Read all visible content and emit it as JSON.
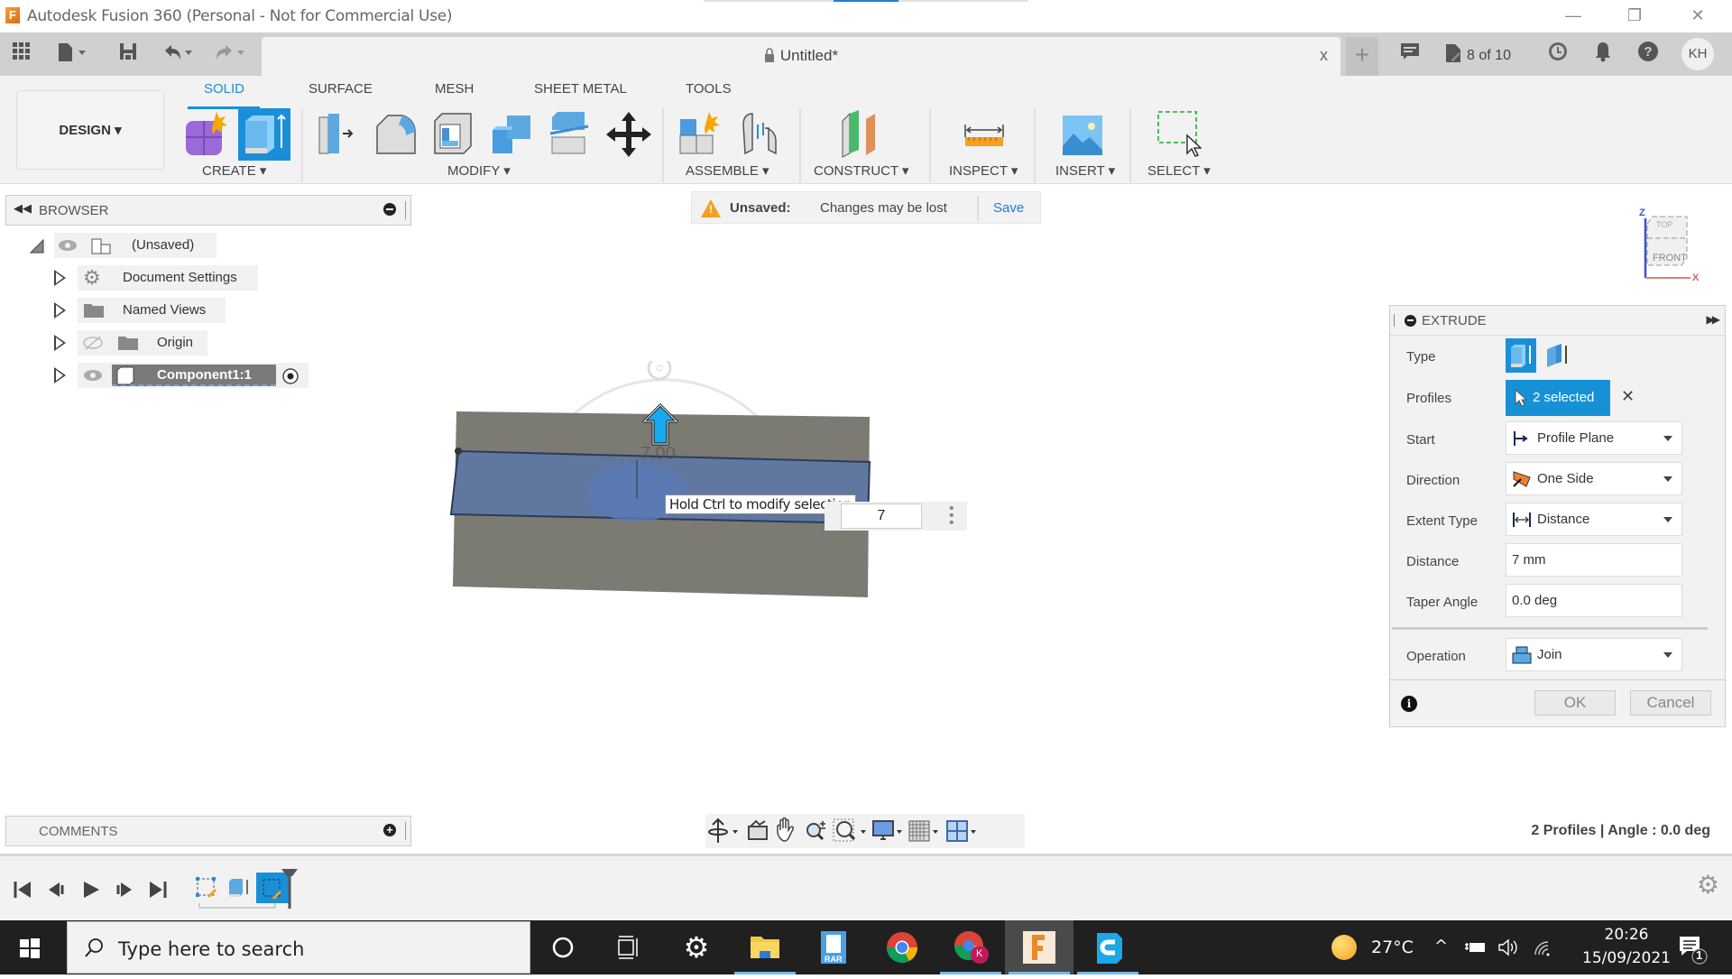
{
  "window": {
    "title": "Autodesk Fusion 360 (Personal - Not for Commercial Use)",
    "minimize": "—",
    "restore": "❐",
    "close": "✕"
  },
  "doc_tabs": {
    "active_title": "Untitled*",
    "close_glyph": "x",
    "new_tab_glyph": "+",
    "job_status": "8 of 10",
    "user_initials": "KH"
  },
  "ribbon": {
    "workspace": "DESIGN ▾",
    "tabs": [
      {
        "label": "SOLID",
        "active": true
      },
      {
        "label": "SURFACE",
        "active": false
      },
      {
        "label": "MESH",
        "active": false
      },
      {
        "label": "SHEET METAL",
        "active": false
      },
      {
        "label": "TOOLS",
        "active": false
      }
    ],
    "groups": [
      {
        "label": "CREATE ▾",
        "icons": [
          "create-form-icon",
          "extrude-icon"
        ]
      },
      {
        "label": "MODIFY ▾",
        "icons": [
          "press-pull-icon",
          "fillet-icon",
          "shell-icon",
          "combine-icon",
          "split-body-icon",
          "move-icon"
        ]
      },
      {
        "label": "ASSEMBLE ▾",
        "icons": [
          "new-component-icon",
          "joint-icon"
        ]
      },
      {
        "label": "CONSTRUCT ▾",
        "icons": [
          "offset-plane-icon"
        ]
      },
      {
        "label": "INSPECT ▾",
        "icons": [
          "measure-icon"
        ]
      },
      {
        "label": "INSERT ▾",
        "icons": [
          "insert-image-icon"
        ]
      },
      {
        "label": "SELECT ▾",
        "icons": [
          "select-window-icon"
        ]
      }
    ]
  },
  "browser": {
    "title": "BROWSER",
    "items": [
      {
        "label": "(Unsaved)",
        "icon": "component-icon"
      },
      {
        "label": "Document Settings",
        "icon": "gear-icon"
      },
      {
        "label": "Named Views",
        "icon": "folder-icon"
      },
      {
        "label": "Origin",
        "icon": "folder-icon"
      },
      {
        "label": "Component1:1",
        "icon": "body-icon"
      }
    ]
  },
  "unsaved_banner": {
    "label": "Unsaved:",
    "message": "Changes may be lost",
    "save": "Save"
  },
  "viewport": {
    "dimension_label": "7.00",
    "tooltip": "Hold Ctrl to modify selection",
    "input_value": "7",
    "viewcube": {
      "top": "TOP",
      "front": "FRONT",
      "axis_z": "Z",
      "axis_x": "X"
    }
  },
  "extrude_dialog": {
    "title": "EXTRUDE",
    "fields": {
      "type": {
        "label": "Type"
      },
      "profiles": {
        "label": "Profiles",
        "value": "2 selected",
        "clear": "✕"
      },
      "start": {
        "label": "Start",
        "value": "Profile Plane"
      },
      "direction": {
        "label": "Direction",
        "value": "One Side"
      },
      "extent_type": {
        "label": "Extent Type",
        "value": "Distance"
      },
      "distance": {
        "label": "Distance",
        "value": "7 mm"
      },
      "taper_angle": {
        "label": "Taper Angle",
        "value": "0.0 deg"
      },
      "operation": {
        "label": "Operation",
        "value": "Join"
      }
    },
    "ok": "OK",
    "cancel": "Cancel",
    "info_glyph": "i"
  },
  "comments": {
    "title": "COMMENTS"
  },
  "status": {
    "text": "2 Profiles | Angle : 0.0 deg"
  },
  "taskbar": {
    "search_placeholder": "Type here to search",
    "weather": "27°C",
    "time": "20:26",
    "date": "15/09/2021",
    "notifications_count": "1",
    "rar_label": "RAR",
    "chrome_profile": "K"
  },
  "colors": {
    "accent": "#1a8fd8",
    "selection_blue": "#1791d6",
    "warning": "#f5a020",
    "taskbar": "#202020"
  }
}
